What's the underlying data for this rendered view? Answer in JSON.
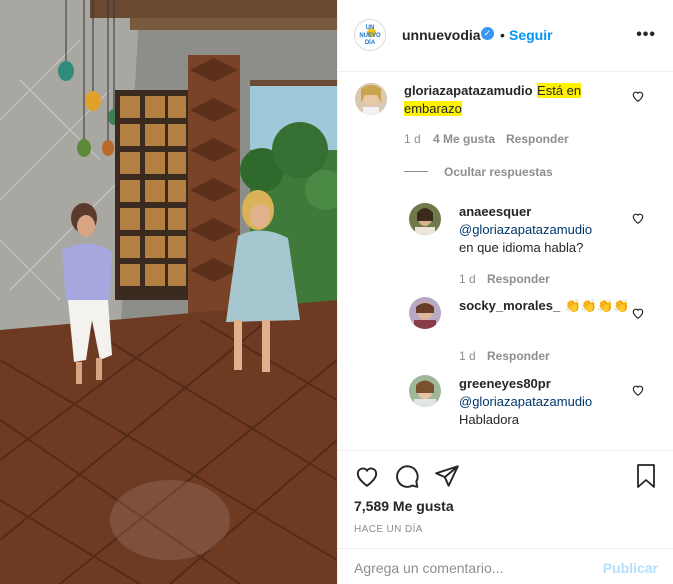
{
  "header": {
    "username": "unnuevodia",
    "brand_line1": "UN",
    "brand_line2": "NUEVO",
    "brand_line3": "DÍA",
    "verified_mark": "✓",
    "separator": "•",
    "follow_label": "Seguir",
    "more_label": "•••"
  },
  "comments": [
    {
      "username": "gloriazapatazamudio",
      "text_line1": "Está en",
      "text_line2": "embarazo",
      "age": "1 d",
      "likes": "4 Me gusta",
      "reply_label": "Responder"
    }
  ],
  "hide_replies_label": "Ocultar respuestas",
  "replies": [
    {
      "username": "anaeesquer",
      "mention": "@gloriazapatazamudio",
      "text": "en que idioma habla?",
      "age": "1 d",
      "reply_label": "Responder"
    },
    {
      "username": "socky_morales_",
      "text": "👏👏👏👏",
      "age": "1 d",
      "reply_label": "Responder"
    },
    {
      "username": "greeneyes80pr",
      "mention": "@gloriazapatazamudio",
      "text": "Habladora"
    }
  ],
  "actions": {
    "like_count": "7,589 Me gusta",
    "timestamp": "HACE UN DÍA"
  },
  "add_comment": {
    "placeholder": "Agrega un comentario...",
    "publish_label": "Publicar"
  },
  "icons": [
    "heart-icon",
    "comment-icon",
    "share-icon",
    "bookmark-icon",
    "more-options-icon",
    "verified-icon"
  ],
  "colors": {
    "link_blue": "#0095f6",
    "mention_blue": "#00376b",
    "highlight": "#fff200",
    "muted": "#8e8e8e"
  }
}
